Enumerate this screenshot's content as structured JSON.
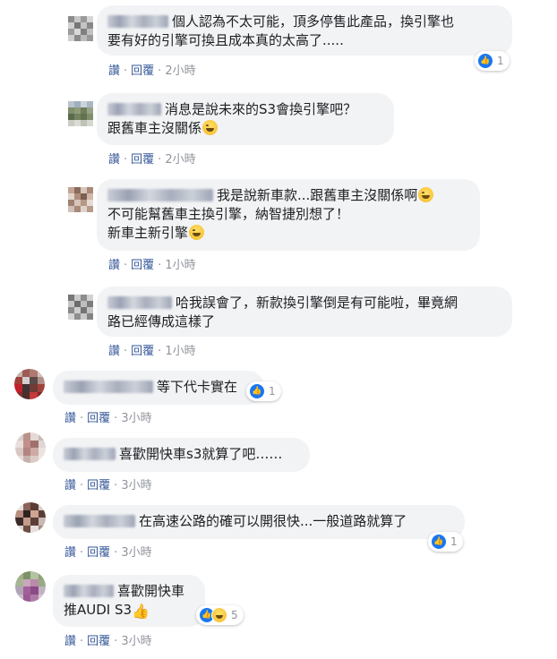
{
  "actions": {
    "like": "讚",
    "reply": "回覆",
    "sep": "·"
  },
  "comments": [
    {
      "lines": [
        "個人認為不太可能，頂多停售此產品，換引擎也",
        "要有好的引擎可換且成本真的太高了....."
      ],
      "time": "2小時",
      "reactions": {
        "count": "1"
      }
    },
    {
      "lines": [
        "消息是說未來的S3會換引擎吧？",
        "跟舊車主沒關係"
      ],
      "time": "2小時"
    },
    {
      "lines": [
        "我是說新車款...跟舊車主沒關係啊",
        "不可能幫舊車主換引擎，納智捷別想了！",
        "新車主新引擎"
      ],
      "time": "1小時"
    },
    {
      "lines": [
        "哈我誤會了，新款換引擎倒是有可能啦，畢竟網",
        "路已經傳成這樣了"
      ],
      "time": "1小時"
    },
    {
      "lines": [
        "等下代卡實在"
      ],
      "time": "3小時",
      "reactions": {
        "count": "1"
      }
    },
    {
      "lines": [
        "喜歡開快車s3就算了吧……"
      ],
      "time": "3小時"
    },
    {
      "lines": [
        "在高速公路的確可以開很快...一般道路就算了"
      ],
      "time": "3小時",
      "reactions": {
        "count": "1"
      }
    },
    {
      "lines": [
        "喜歡開快車",
        "推AUDI S3"
      ],
      "time": "3小時",
      "reactions": {
        "count": "5"
      }
    }
  ]
}
